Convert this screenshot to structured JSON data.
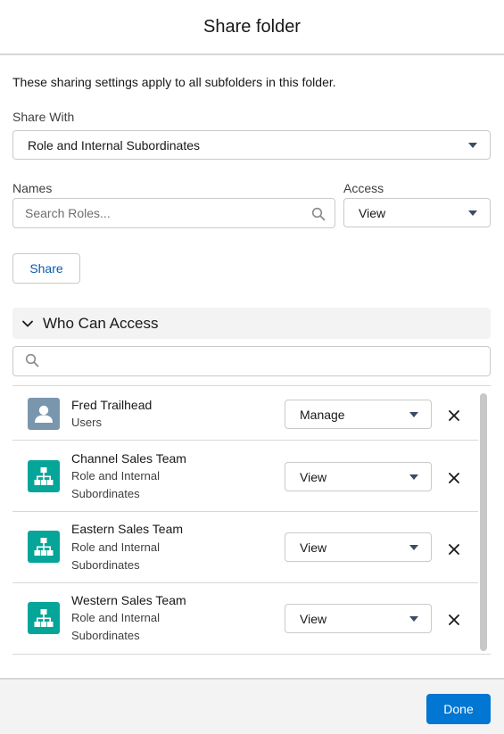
{
  "dialog": {
    "title": "Share folder"
  },
  "intro_text": "These sharing settings apply to all subfolders in this folder.",
  "share_with": {
    "label": "Share With",
    "selected": "Role and Internal Subordinates"
  },
  "names": {
    "label": "Names",
    "placeholder": "Search Roles..."
  },
  "access": {
    "label": "Access",
    "selected": "View"
  },
  "share_button": "Share",
  "who_can_access": {
    "title": "Who Can Access",
    "search_placeholder": "",
    "entries": [
      {
        "name": "Fred Trailhead",
        "type_line1": "Users",
        "type_line2": "",
        "access": "Manage",
        "icon": "user-avatar-icon"
      },
      {
        "name": "Channel Sales Team",
        "type_line1": "Role and Internal",
        "type_line2": "Subordinates",
        "access": "View",
        "icon": "hierarchy-icon"
      },
      {
        "name": "Eastern Sales Team",
        "type_line1": "Role and Internal",
        "type_line2": "Subordinates",
        "access": "View",
        "icon": "hierarchy-icon"
      },
      {
        "name": "Western Sales Team",
        "type_line1": "Role and Internal",
        "type_line2": "Subordinates",
        "access": "View",
        "icon": "hierarchy-icon"
      }
    ]
  },
  "done_button": "Done",
  "colors": {
    "brand": "#0176d3",
    "role_icon": "#06a59a",
    "link": "#0b5cab"
  }
}
